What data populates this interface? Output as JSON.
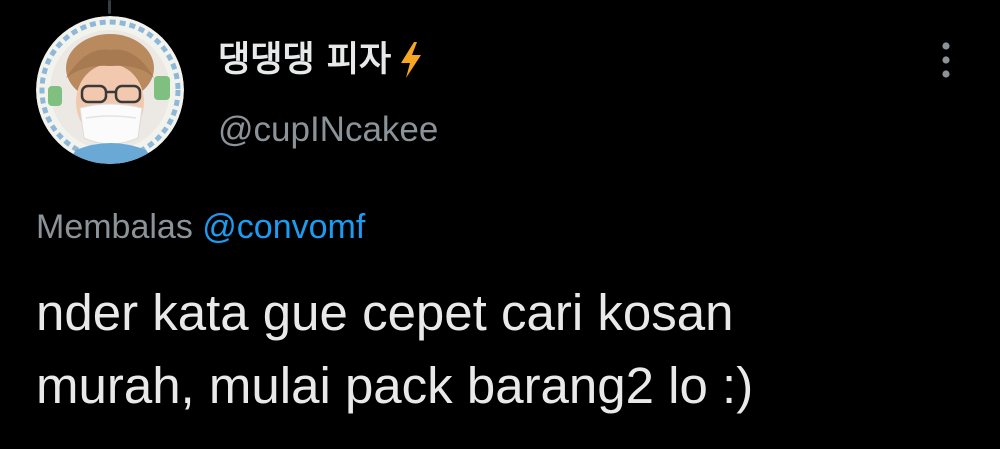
{
  "tweet": {
    "author": {
      "display_name": "댕댕댕 피자",
      "display_name_emoji": "lightning-bolt-icon",
      "handle": "@cupINcakee",
      "avatar": "profile-photo-person-with-glasses-and-mask"
    },
    "reply_context": {
      "label": "Membalas",
      "target": "@convomf"
    },
    "text": "nder kata gue cepet cari kosan\nmurah, mulai pack barang2 lo :)",
    "menu_icon": "vertical-ellipsis-icon"
  },
  "colors": {
    "background": "#000000",
    "text_primary": "#e7e9ea",
    "text_secondary": "#8b9298",
    "link": "#1d9bf0",
    "bolt": "#f6a623"
  }
}
